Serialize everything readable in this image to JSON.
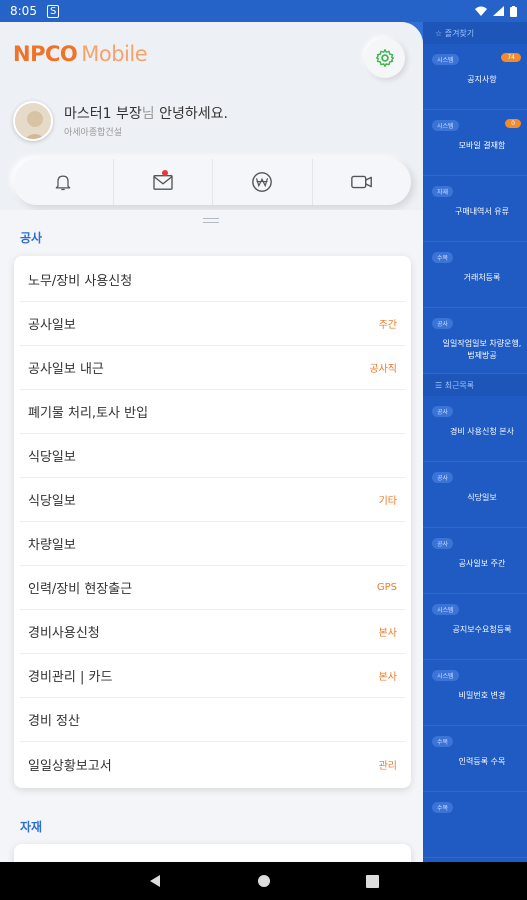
{
  "status_bar": {
    "time": "8:05",
    "app_icon": "S"
  },
  "header": {
    "logo_bold": "NPCO",
    "logo_light": "Mobile",
    "greeting_name": "마스터1 부장",
    "greeting_suffix_nim": "님",
    "greeting_rest": " 안녕하세요.",
    "company": "아세아종합건설"
  },
  "sections": [
    {
      "title": "공사",
      "items": [
        {
          "label": "노무/장비 사용신청",
          "tag": ""
        },
        {
          "label": "공사일보",
          "tag": "주간"
        },
        {
          "label": "공사일보 내근",
          "tag": "공사직"
        },
        {
          "label": "폐기물 처리,토사 반입",
          "tag": ""
        },
        {
          "label": "식당일보",
          "tag": ""
        },
        {
          "label": "식당일보",
          "tag": "기타"
        },
        {
          "label": "차량일보",
          "tag": ""
        },
        {
          "label": "인력/장비 현장출근",
          "tag": "GPS"
        },
        {
          "label": "경비사용신청",
          "tag": "본사"
        },
        {
          "label": "경비관리 | 카드",
          "tag": "본사"
        },
        {
          "label": "경비 정산",
          "tag": ""
        },
        {
          "label": "일일상황보고서",
          "tag": "관리"
        }
      ]
    },
    {
      "title": "자재",
      "items": []
    }
  ],
  "right_panel": {
    "favorites_header": "☆ 즐겨찾기",
    "recent_header": "☰ 최근목록",
    "favorites": [
      {
        "tag": "시스템",
        "title": "공지사항",
        "badge": "74"
      },
      {
        "tag": "시스템",
        "title": "모바일 결재함",
        "badge": "0"
      },
      {
        "tag": "자재",
        "title": "구매내역서 유류",
        "badge": ""
      },
      {
        "tag": "수목",
        "title": "거래처등록",
        "badge": ""
      },
      {
        "tag": "공사",
        "title": "일일작업일보 차량운행, 법제방공",
        "badge": ""
      }
    ],
    "recent": [
      {
        "tag": "공사",
        "title": "경비 사용신청 본사"
      },
      {
        "tag": "공사",
        "title": "식당일보"
      },
      {
        "tag": "공사",
        "title": "공사일보 주간"
      },
      {
        "tag": "시스템",
        "title": "공지보수요청등록"
      },
      {
        "tag": "시스템",
        "title": "비밀번호 변경"
      },
      {
        "tag": "수목",
        "title": "인력등록 수목"
      },
      {
        "tag": "수목",
        "title": ""
      }
    ]
  },
  "colors": {
    "accent_orange": "#f07a28",
    "primary_blue": "#2a6fd1",
    "panel_blue": "#1f5bc2"
  },
  "icons": [
    "settings-gear-icon",
    "bell-icon",
    "mail-icon",
    "won-icon",
    "video-icon"
  ]
}
